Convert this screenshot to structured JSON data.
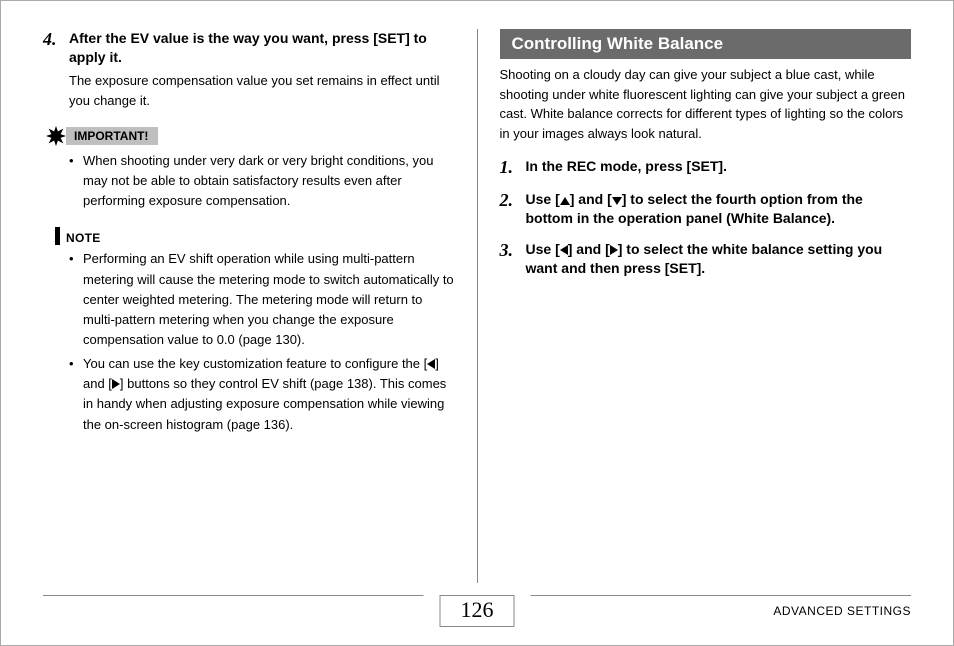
{
  "left": {
    "step4_num": "4.",
    "step4_title": "After the EV value is the way you want, press [SET] to apply it.",
    "step4_desc": "The exposure compensation value you set remains in effect until you change it.",
    "important_label": "IMPORTANT!",
    "important_bullets": [
      "When shooting under very dark or very bright conditions, you may not be able to obtain satisfactory results even after performing exposure compensation."
    ],
    "note_label": "NOTE",
    "note_bullet1": "Performing an EV shift operation while using multi-pattern metering will cause the metering mode to switch automatically to center weighted metering. The metering mode will return to multi-pattern metering when you change the exposure compensation value to 0.0 (page 130).",
    "note_bullet2_a": "You can use the key customization feature to configure the [",
    "note_bullet2_b": "] and [",
    "note_bullet2_c": "] buttons so they control EV shift (page 138). This comes in handy when adjusting exposure compensation while viewing the on-screen histogram (page 136)."
  },
  "right": {
    "section_title": "Controlling White Balance",
    "intro": "Shooting on a cloudy day can give your subject a blue cast, while shooting under white fluorescent lighting can give your subject a green cast. White balance corrects for different types of lighting so the colors in your images always look natural.",
    "step1_num": "1.",
    "step1_title": "In the REC mode, press [SET].",
    "step2_num": "2.",
    "step2_a": "Use [",
    "step2_b": "] and [",
    "step2_c": "] to select the fourth option from the bottom in the operation panel (White Balance).",
    "step3_num": "3.",
    "step3_a": "Use [",
    "step3_b": "] and [",
    "step3_c": "] to select the white balance setting you want and then press [SET]."
  },
  "footer": {
    "page_number": "126",
    "section_name": "ADVANCED SETTINGS"
  }
}
